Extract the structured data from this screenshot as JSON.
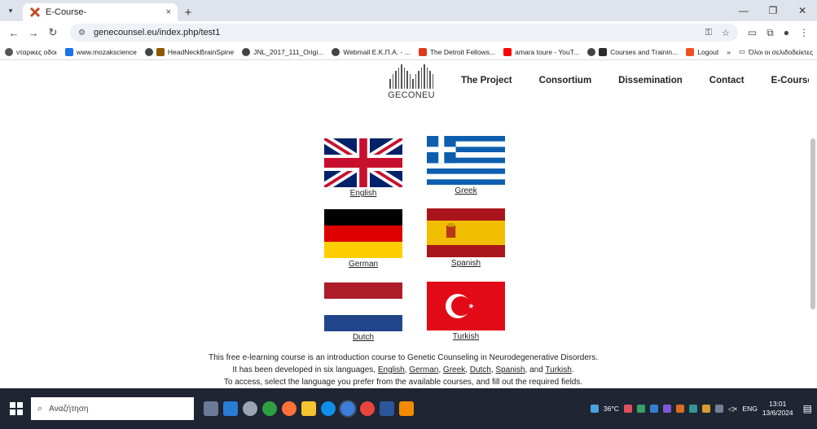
{
  "browser": {
    "tab_title": "E-Course-",
    "url": "genecounsel.eu/index.php/test1",
    "new_tab": "+",
    "close_tab": "×",
    "win_minimize": "—",
    "win_restore": "❐",
    "win_close": "✕"
  },
  "bookmarks": {
    "items": [
      "νταρικες οδοι",
      "www.mozakscience",
      "HeadNeckBrainSpine",
      "JNL_2017_111_Origi...",
      "Webmail E.K.Π.Α. - ...",
      "The Detroit Fellows...",
      "amara toure - YouT...",
      "Courses and Trainin...",
      "Logout"
    ],
    "more": "»",
    "all_bookmarks": "Όλοι οι σελιδοδείκτες"
  },
  "site": {
    "logo_text": "GECONEU",
    "nav": [
      "The Project",
      "Consortium",
      "Dissemination",
      "Contact",
      "E-Course"
    ]
  },
  "languages": {
    "english": "English",
    "greek": "Greek",
    "german": "German",
    "spanish": "Spanish",
    "dutch": "Dutch",
    "turkish": "Turkish"
  },
  "description": {
    "line1": "This free e-learning course is an introduction course to Genetic Counseling in Neurodegenerative Disorders.",
    "line2_prefix": "It has been developed in six languages, ",
    "sep_comma": ", ",
    "sep_and": ", and ",
    "period": ".",
    "line3": "To access, select the language you prefer from the available courses, and fill out the required fields."
  },
  "taskbar": {
    "search_placeholder": "Αναζήτηση",
    "temperature": "36°C",
    "lang": "ENG",
    "time": "13:01",
    "date": "13/6/2024"
  },
  "colors": {
    "uk_blue": "#012169",
    "uk_red": "#C8102E",
    "greek_blue": "#0D5EAF",
    "german_gold": "#FFCE00",
    "german_red": "#DD0000",
    "spain_red": "#AA151B",
    "spain_yellow": "#F1BF00",
    "dutch_red": "#AE1C28",
    "dutch_blue": "#21468B",
    "turkey_red": "#E30A17"
  }
}
